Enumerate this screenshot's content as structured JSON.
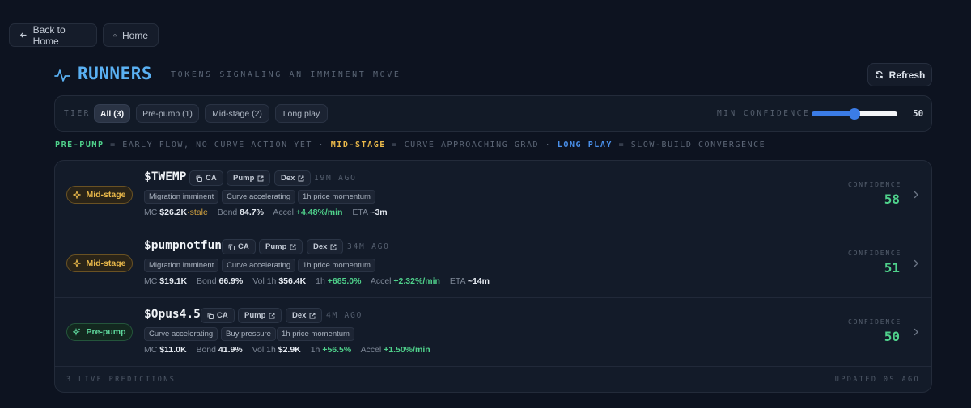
{
  "nav": {
    "back_label": "Back to Home",
    "home_label": "Home"
  },
  "header": {
    "title": "RUNNERS",
    "subtitle": "TOKENS SIGNALING AN IMMINENT MOVE",
    "refresh_label": "Refresh"
  },
  "filters": {
    "tier_label": "TIER",
    "chips": [
      "All (3)",
      "Pre-pump (1)",
      "Mid-stage (2)",
      "Long play"
    ],
    "active": "All (3)",
    "min_confidence_label": "MIN CONFIDENCE",
    "min_confidence_value": "50",
    "min_confidence_fraction": 0.5
  },
  "legend": {
    "pre_pump_key": "PRE-PUMP",
    "pre_pump_text": "= EARLY FLOW, NO CURVE ACTION YET ·",
    "mid_stage_key": "MID-STAGE",
    "mid_stage_text": "= CURVE APPROACHING GRAD ·",
    "long_play_key": "LONG PLAY",
    "long_play_text": "= SLOW-BUILD CONVERGENCE",
    "colors": {
      "pre": "#4fd18b",
      "mid": "#e9b84a",
      "long": "#4a90ea"
    }
  },
  "predictions": [
    {
      "stage": "Mid-stage",
      "ticker": "$TWEMP",
      "ca_label": "CA",
      "pump_label": "Pump",
      "dex_label": "Dex",
      "age": "19M AGO",
      "tags": [
        "Migration imminent",
        "Curve accelerating",
        "1h price momentum"
      ],
      "mc_key": "MC",
      "mc": "$26.2K",
      "stale": "·stale",
      "bond_key": "Bond",
      "bond": "84.7%",
      "accel_key": "Accel",
      "accel": "+4.48%/min",
      "eta_key": "ETA",
      "eta": "~3m",
      "confidence_label": "CONFIDENCE",
      "confidence": "58"
    },
    {
      "stage": "Mid-stage",
      "ticker": "$pumpnotfun",
      "ca_label": "CA",
      "pump_label": "Pump",
      "dex_label": "Dex",
      "age": "34M AGO",
      "tags": [
        "Migration imminent",
        "Curve accelerating",
        "1h price momentum"
      ],
      "mc_key": "MC",
      "mc": "$19.1K",
      "bond_key": "Bond",
      "bond": "66.9%",
      "vol_key": "Vol 1h",
      "vol": "$56.4K",
      "h1_key": "1h",
      "h1": "+685.0%",
      "accel_key": "Accel",
      "accel": "+2.32%/min",
      "eta_key": "ETA",
      "eta": "~14m",
      "confidence_label": "CONFIDENCE",
      "confidence": "51"
    },
    {
      "stage": "Pre-pump",
      "ticker": "$Opus4.5",
      "ca_label": "CA",
      "pump_label": "Pump",
      "dex_label": "Dex",
      "age": "4M AGO",
      "tags": [
        "Curve accelerating",
        "Buy pressure",
        "1h price momentum"
      ],
      "mc_key": "MC",
      "mc": "$11.0K",
      "bond_key": "Bond",
      "bond": "41.9%",
      "vol_key": "Vol 1h",
      "vol": "$2.9K",
      "h1_key": "1h",
      "h1": "+56.5%",
      "accel_key": "Accel",
      "accel": "+1.50%/min",
      "confidence_label": "CONFIDENCE",
      "confidence": "50"
    }
  ],
  "footer": {
    "live_count": "3 LIVE PREDICTIONS",
    "updated": "UPDATED 0S AGO"
  }
}
